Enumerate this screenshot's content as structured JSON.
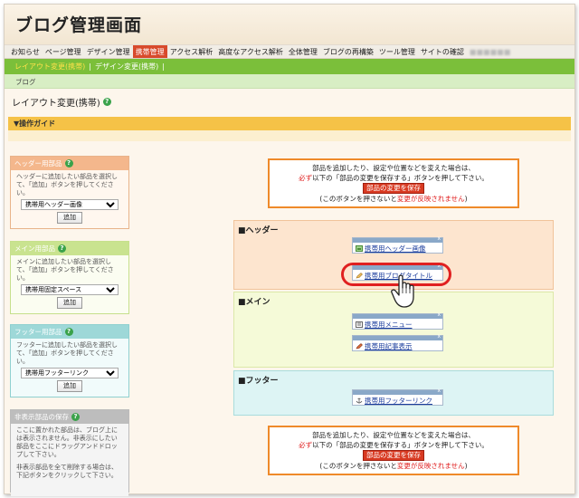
{
  "app": {
    "title": "ブログ管理画面"
  },
  "menu": [
    {
      "label": "お知らせ",
      "active": false
    },
    {
      "label": "ページ管理",
      "active": false
    },
    {
      "label": "デザイン管理",
      "active": false
    },
    {
      "label": "携帯管理",
      "active": true
    },
    {
      "label": "アクセス解析",
      "active": false
    },
    {
      "label": "高度なアクセス解析",
      "active": false
    },
    {
      "label": "全体管理",
      "active": false
    },
    {
      "label": "ブログの再構築",
      "active": false
    },
    {
      "label": "ツール管理",
      "active": false
    },
    {
      "label": "サイトの確認",
      "active": false
    }
  ],
  "submenu": [
    {
      "label": "レイアウト変更(携帯)",
      "active": true
    },
    {
      "label": "デザイン変更(携帯)",
      "active": false
    }
  ],
  "submenu_separator": "|",
  "breadcrumb": "ブログ",
  "page_title": "レイアウト変更(携帯)",
  "help_glyph": "?",
  "guide_label": "▼操作ガイド",
  "left_panels": {
    "header": {
      "title": "ヘッダー用部品",
      "description": "ヘッダーに追加したい部品を選択して、「追加」ボタンを押してください。",
      "select_value": "携帯用ヘッダー画像",
      "button": "追加"
    },
    "main": {
      "title": "メイン用部品",
      "description": "メインに追加したい部品を選択して、「追加」ボタンを押してください。",
      "select_value": "携帯用固定スペース",
      "button": "追加"
    },
    "footer": {
      "title": "フッター用部品",
      "description": "フッターに追加したい部品を選択して、「追加」ボタンを押してください。",
      "select_value": "携帯用フッターリンク",
      "button": "追加"
    },
    "hidden": {
      "title": "非表示部品の保存",
      "description1": "ここに置かれた部品は、ブログ上には表示されません。非表示にしたい部品をここにドラッグアンドドロップして下さい。",
      "description2": "非表示部品を全て削除する場合は、下記ボタンをクリックして下さい。"
    }
  },
  "save_notice": {
    "line1": "部品を追加したり、設定や位置などを変えた場合は、",
    "line2_red": "必ず",
    "line2_rest": "以下の「部品の変更を保存する」ボタンを押して下さい。",
    "button": "部品の変更を保存",
    "line4_a": "(このボタンを押さないと",
    "line4_red": "変更が反映されません",
    "line4_b": ")"
  },
  "areas": {
    "header": {
      "label": "■ヘッダー",
      "parts": [
        {
          "label": "携帯用ヘッダー画像",
          "icon": "image-icon"
        },
        {
          "label": "携帯用ブログタイトル",
          "icon": "pencil-icon"
        }
      ]
    },
    "main": {
      "label": "■メイン",
      "parts": [
        {
          "label": "携帯用メニュー",
          "icon": "menu-icon"
        },
        {
          "label": "携帯用記事表示",
          "icon": "pencil-icon"
        }
      ]
    },
    "footer": {
      "label": "■フッター",
      "parts": [
        {
          "label": "携帯用フッターリンク",
          "icon": "anchor-icon"
        }
      ]
    }
  },
  "part_close_glyph": "x",
  "colors": {
    "menu_active": "#d84a2c",
    "submenu_bg": "#7bbf3a",
    "guide_bg": "#f5c247",
    "header_area": "#fde5cf",
    "main_area": "#f5fad8",
    "footer_area": "#ddf4f4",
    "highlight": "#e02020",
    "link": "#1a3c9c"
  }
}
